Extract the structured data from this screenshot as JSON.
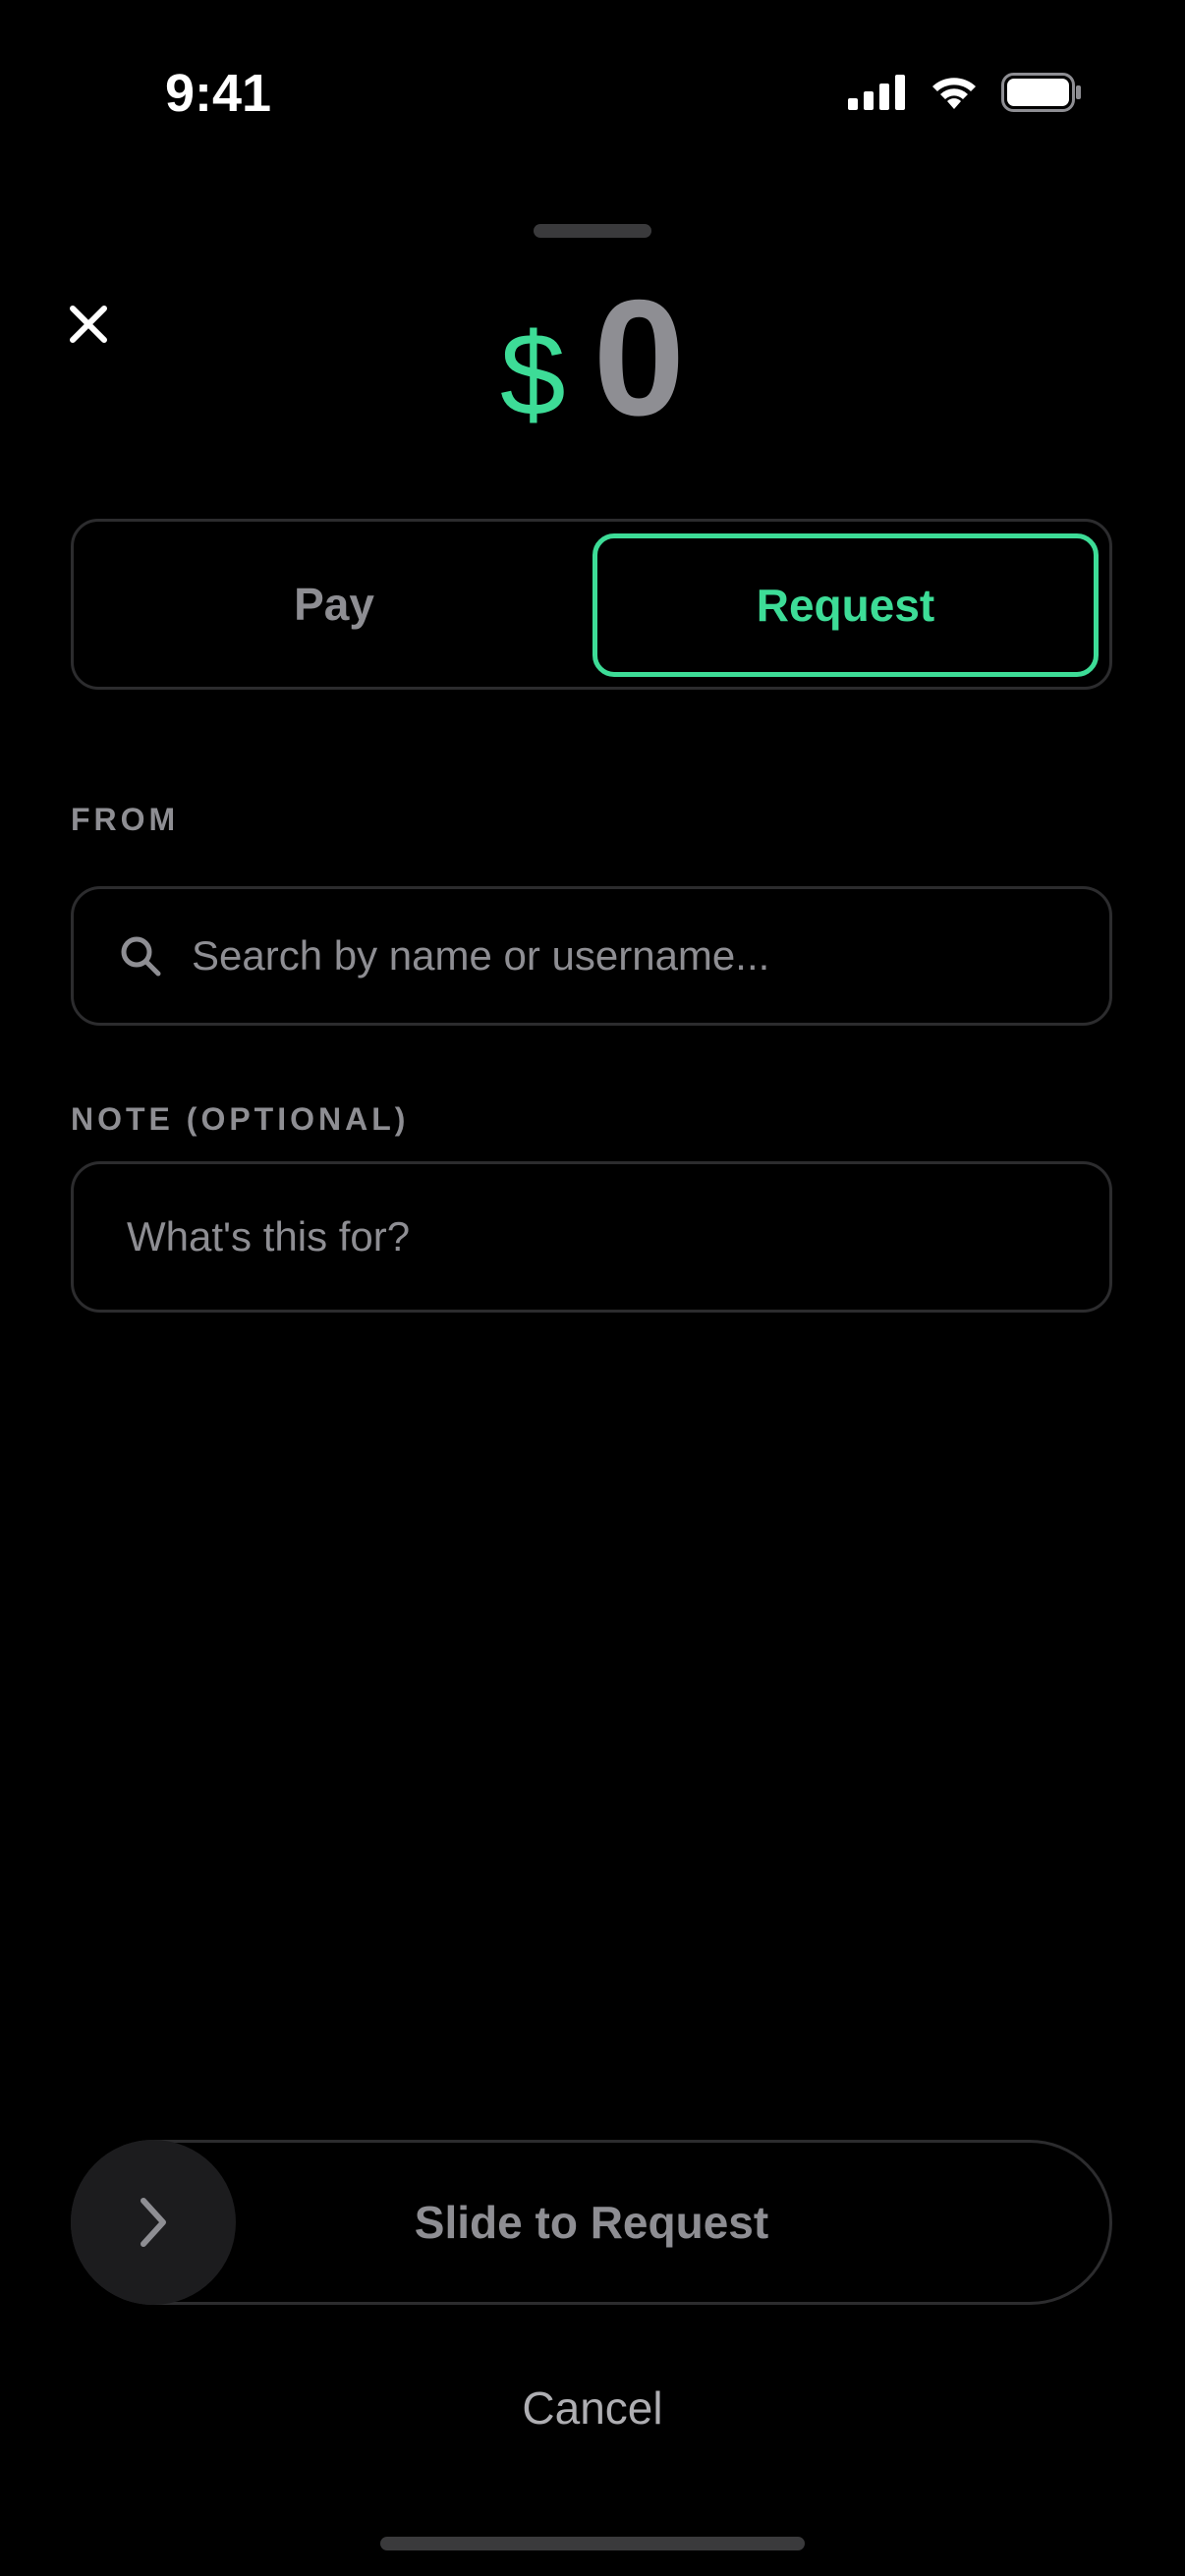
{
  "status_bar": {
    "time": "9:41"
  },
  "header": {
    "close_icon": "close-icon"
  },
  "amount": {
    "currency_symbol": "$",
    "value": "0"
  },
  "segmented_control": {
    "options": [
      {
        "label": "Pay",
        "selected": false
      },
      {
        "label": "Request",
        "selected": true
      }
    ]
  },
  "from_section": {
    "label": "FROM",
    "search_placeholder": "Search by name or username...",
    "search_value": ""
  },
  "note_section": {
    "label": "NOTE (OPTIONAL)",
    "placeholder": "What's this for?",
    "value": ""
  },
  "slider": {
    "label": "Slide to Request",
    "knob_icon": "chevron-right-icon"
  },
  "cancel_label": "Cancel",
  "colors": {
    "accent": "#3ddc97",
    "background": "#000000",
    "muted_text": "#8e8e93",
    "border": "#2c2c2e"
  }
}
